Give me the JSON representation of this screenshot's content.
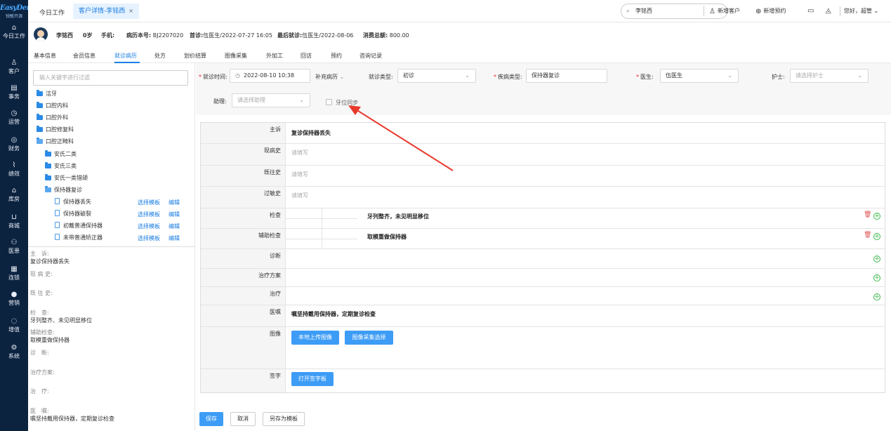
{
  "brand": {
    "name": "EasyDent",
    "sub": "锐敏开源"
  },
  "nav": [
    {
      "label": "今日工作",
      "icon": "home-icon"
    },
    {
      "label": "客户",
      "icon": "user-icon"
    },
    {
      "label": "事务",
      "icon": "task-icon"
    },
    {
      "label": "运营",
      "icon": "clock-icon"
    },
    {
      "label": "财务",
      "icon": "money-icon"
    },
    {
      "label": "绩效",
      "icon": "chart-icon"
    },
    {
      "label": "库房",
      "icon": "warehouse-icon"
    },
    {
      "label": "商城",
      "icon": "cart-icon"
    },
    {
      "label": "医患",
      "icon": "doctor-patient-icon"
    },
    {
      "label": "连锁",
      "icon": "chain-icon"
    },
    {
      "label": "营销",
      "icon": "marketing-icon"
    },
    {
      "label": "增值",
      "icon": "value-icon"
    },
    {
      "label": "系统",
      "icon": "settings-icon"
    }
  ],
  "top": {
    "tab_today": "今日工作",
    "tab_current": "客户详情-李铭西",
    "tab_close": "×",
    "search_value": "李铭西",
    "new_customer": "新增客户",
    "new_appointment": "新增预约",
    "greeting": "您好，超管"
  },
  "patient": {
    "name": "李铭西",
    "age": "0岁",
    "phone_label": "手机:",
    "record_label": "病历本号:",
    "record_no": "BJ2207020",
    "first_label": "首诊:",
    "first_visit": "伍医生/2022-07-27 16:05",
    "last_label": "最后就诊:",
    "last_visit": "伍医生/2022-08-06",
    "total_label": "消费总额:",
    "total": "800.00"
  },
  "subtabs": [
    "基本信息",
    "会员信息",
    "就诊病历",
    "处方",
    "划价结算",
    "图像采集",
    "外加工",
    "回访",
    "预约",
    "咨询记录"
  ],
  "left": {
    "filter_placeholder": "输入关键字进行过滤",
    "tree": [
      "洁牙",
      "口腔内科",
      "口腔外科",
      "口腔修复科",
      "口腔正畸科",
      "安氏二类",
      "安氏三类",
      "安氏一类错颌",
      "保持器复诊"
    ],
    "templates": [
      "保持器丢失",
      "保持器破裂",
      "初戴普通保持器",
      "未带普通矫正器"
    ],
    "select_tmpl": "选择模板",
    "edit": "编辑",
    "summary": {
      "chief_label": "主　诉:",
      "chief": "复诊保持器丢失",
      "present_label": "现 病 史:",
      "past_label": "既 往 史:",
      "exam_label": "检　查:",
      "exam": "牙列整齐、未见明显移位",
      "aux_label": "辅助检查:",
      "aux": "取模重做保持器",
      "diag_label": "诊　断:",
      "plan_label": "治疗方案:",
      "treat_label": "治　疗:",
      "advice_label": "医　嘱:",
      "advice": "嘱坚持戴用保持器，定期复诊检查"
    }
  },
  "form": {
    "visit_time_label": "就诊时间:",
    "visit_time": "2022-08-10 10:38",
    "supplement": "补充病历",
    "visit_type_label": "就诊类型:",
    "visit_type": "初诊",
    "disease_type_label": "疾病类型:",
    "disease_type": "保持器复诊",
    "doctor_label": "医生:",
    "doctor": "伍医生",
    "nurse_label": "护士:",
    "nurse_placeholder": "请选择护士",
    "assistant_label": "助理:",
    "assistant_placeholder": "请选择助理",
    "tooth_sync": "牙位同步"
  },
  "record": {
    "chief_label": "主诉",
    "chief": "复诊保持器丢失",
    "present_label": "现病史",
    "past_label": "既往史",
    "allergy_label": "过敏史",
    "placeholder": "请填写",
    "exam_label": "检查",
    "exam": "牙列整齐，未见明显移位",
    "aux_label": "辅助检查",
    "aux": "取模重做保持器",
    "diag_label": "诊断",
    "plan_label": "治疗方案",
    "treat_label": "治疗",
    "advice_label": "医嘱",
    "advice": "嘱坚持戴用保持器，定期复诊检查",
    "image_label": "图像",
    "upload_local": "本地上传图像",
    "select_capture": "图像采集选择",
    "sign_label": "签字",
    "open_sign": "打开签字板"
  },
  "footer": {
    "save": "保存",
    "cancel": "取消",
    "save_tmpl": "另存为模板"
  },
  "colors": {
    "accent": "#3d9cf5",
    "rail": "#0c2340",
    "annotation": "#e8392b"
  }
}
